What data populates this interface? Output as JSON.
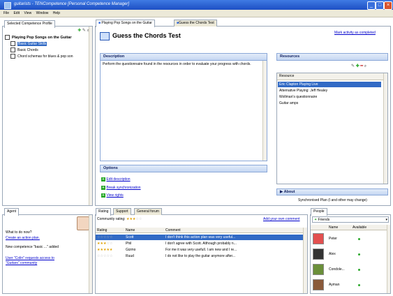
{
  "window": {
    "title": "guitarists - TENCompetence [Personal Competence Manager]"
  },
  "menu": [
    "File",
    "Edit",
    "View",
    "Window",
    "Help"
  ],
  "left_panel": {
    "tab": "Selected Competence Profile",
    "profile": "Playing Pop Songs on the Guitar",
    "items": [
      "Basic Guitar Skills",
      "Basic Chords",
      "Chord schemas for blues & pop son"
    ]
  },
  "main": {
    "tabs": [
      "Playing Pop Songs on the Guitar",
      "Guess the Chords Test"
    ],
    "title": "Guess the Chords Test",
    "mark_completed": "Mark activity as completed",
    "description_label": "Description",
    "description_text": "Perform the questionnaire found in the resources in order to evaluate your progress with chords.",
    "resources_label": "Resources",
    "resource_col": "Resource",
    "resources": [
      "Eric Clapton Playing Live",
      "Alternative Playing: Jeff Healey",
      "Wollman's questionnaire",
      "Guitar amps"
    ],
    "options_label": "Options",
    "options": [
      "Edit description",
      "Break synchronization",
      "View rights"
    ],
    "about_label": "About",
    "sync_text": "Synchronised Plan (I and other may change)"
  },
  "agent": {
    "tab": "Agent",
    "question": "What to do now?",
    "action_link": "Create an action plan.",
    "message": "New competence \"basic ...\" added",
    "request_line1": "User \"Colin\" requests access to",
    "request_line2": "\"Guitars\" community"
  },
  "rating_panel": {
    "tabs": [
      "Rating",
      "Support",
      "General forum"
    ],
    "community_label": "Community rating:",
    "community_stars": 3,
    "add_comment": "Add your own comment",
    "columns": [
      "Rating",
      "Name",
      "Comment"
    ],
    "rows": [
      {
        "stars": 0,
        "name": "Scott",
        "comment": "I don't think this action plan was very useful..."
      },
      {
        "stars": 3,
        "name": "Phil",
        "comment": "I don't agree with Scott. Although probably n..."
      },
      {
        "stars": 5,
        "name": "Gizmo",
        "comment": "For me it was very usefull. I am new and I re..."
      },
      {
        "stars": 0,
        "name": "Ruud",
        "comment": "I do not like to play the guitar anymore after..."
      }
    ]
  },
  "people_panel": {
    "tab": "People",
    "filter": "Friends",
    "columns": [
      "Name",
      "Available"
    ],
    "people": [
      "Peter",
      "Alex",
      "Condole...",
      "Ayman"
    ]
  },
  "colors": {
    "accent": "#316ac5",
    "link": "#0000cc",
    "titlebar": "#245edb",
    "available": "#2aa82a"
  },
  "icons": [
    "app-icon",
    "minimize-icon",
    "maximize-icon",
    "close-icon",
    "task-icon",
    "add-icon",
    "remove-icon",
    "search-icon",
    "edit-icon",
    "friends-icon"
  ]
}
